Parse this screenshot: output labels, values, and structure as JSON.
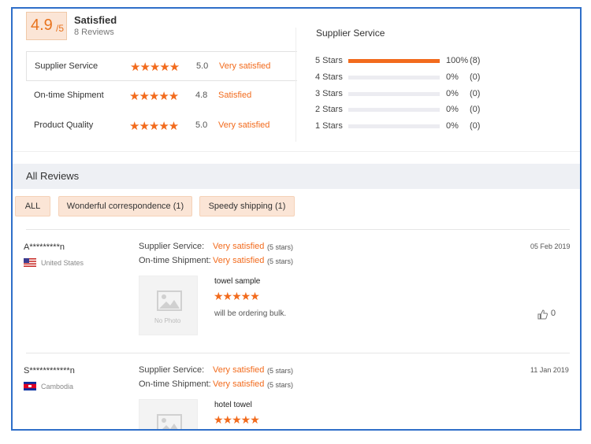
{
  "summary": {
    "score": "4.9",
    "score_scale": "/5",
    "status": "Satisfied",
    "reviews_count": "8 Reviews"
  },
  "metrics": [
    {
      "label": "Supplier Service",
      "stars": "★★★★★",
      "value": "5.0",
      "word": "Very satisfied"
    },
    {
      "label": "On-time Shipment",
      "stars": "★★★★★",
      "value": "4.8",
      "word": "Satisfied"
    },
    {
      "label": "Product Quality",
      "stars": "★★★★★",
      "value": "5.0",
      "word": "Very satisfied"
    }
  ],
  "distribution": {
    "title": "Supplier Service",
    "rows": [
      {
        "label": "5 Stars",
        "fill": 1.0,
        "pct": "100%",
        "count": "(8)"
      },
      {
        "label": "4 Stars",
        "fill": 0.0,
        "pct": "0%",
        "count": "(0)"
      },
      {
        "label": "3 Stars",
        "fill": 0.0,
        "pct": "0%",
        "count": "(0)"
      },
      {
        "label": "2 Stars",
        "fill": 0.0,
        "pct": "0%",
        "count": "(0)"
      },
      {
        "label": "1 Stars",
        "fill": 0.0,
        "pct": "0%",
        "count": "(0)"
      }
    ]
  },
  "all_reviews": {
    "title": "All Reviews",
    "filters": [
      "ALL",
      "Wonderful correspondence (1)",
      "Speedy shipping (1)"
    ]
  },
  "reviews": [
    {
      "name": "A*********n",
      "country": "United States",
      "supplier_label": "Supplier Service:",
      "supplier_value": "Very satisfied",
      "supplier_stars": "(5 stars)",
      "shipment_label": "On-time Shipment:",
      "shipment_value": "Very satisfied",
      "shipment_stars": "(5 stars)",
      "date": "05 Feb 2019",
      "no_photo": "No Photo",
      "title": "towel sample",
      "stars": "★★★★★",
      "text": "will be ordering bulk.",
      "likes": "0"
    },
    {
      "name": "S************n",
      "country": "Cambodia",
      "supplier_label": "Supplier Service:",
      "supplier_value": "Very satisfied",
      "supplier_stars": "(5 stars)",
      "shipment_label": "On-time Shipment:",
      "shipment_value": "Very satisfied",
      "shipment_stars": "(5 stars)",
      "date": "11 Jan 2019",
      "title": "hotel towel",
      "stars": "★★★★★"
    }
  ],
  "colors": {
    "accent": "#f26b1d",
    "frame": "#2f6fc9",
    "chip_bg": "#fbe5d6"
  }
}
